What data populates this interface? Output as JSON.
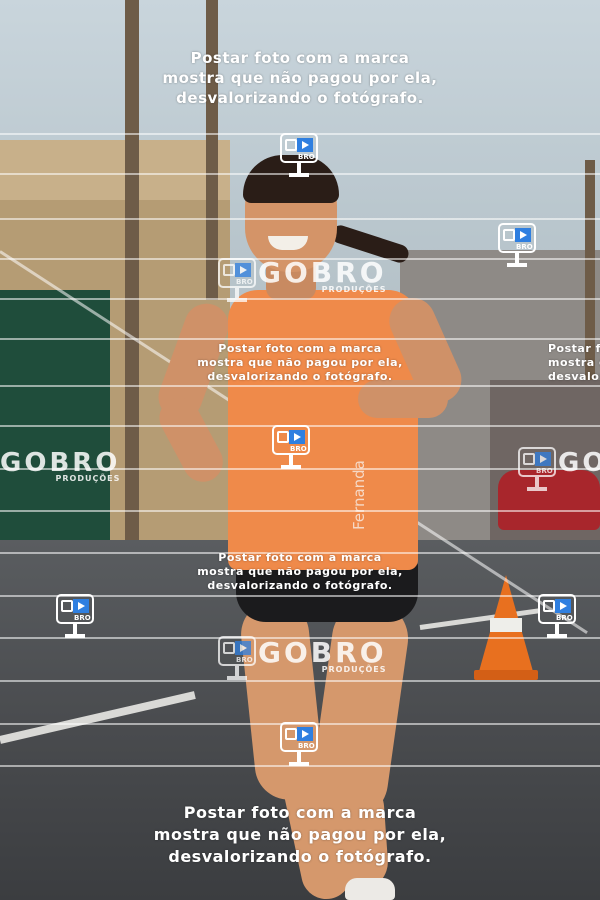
{
  "watermark": {
    "line1": "Postar foto com a marca",
    "line2": "mostra que não pagou por ela,",
    "line3": "desvalorizando o fotógrafo.",
    "brand": "GOBRO",
    "brand_sub": "PRODUÇÕES",
    "cam_label": "BRO",
    "line_color": "#ffffff",
    "icon_screen_color": "#2f7fe0"
  },
  "scene": {
    "tank_print": "Fernanda",
    "tank_color": "#ef8a4a",
    "shorts_color": "#1b1b1d",
    "cone_color": "#e8701f",
    "car_color": "#a8262c",
    "wall_color": "#1f4d3b"
  }
}
